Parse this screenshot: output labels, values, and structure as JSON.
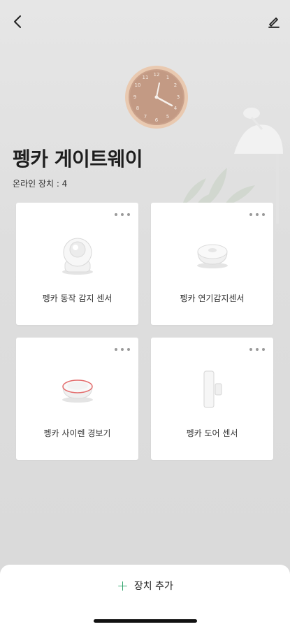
{
  "header": {
    "back_icon": "chevron-left-icon",
    "edit_icon": "pencil-icon"
  },
  "hub": {
    "title": "펭카 게이트웨이",
    "online_label": "온라인 장치 :  4"
  },
  "devices": [
    {
      "name": "펭카 동작 감지 센서",
      "icon": "motion-sensor-icon"
    },
    {
      "name": "펭카 연기감지센서",
      "icon": "smoke-detector-icon"
    },
    {
      "name": "펭카 사이렌 경보기",
      "icon": "siren-icon"
    },
    {
      "name": "펭카 도어 센서",
      "icon": "door-sensor-icon"
    }
  ],
  "footer": {
    "add_label": "장치 추가",
    "accent": "#2fa36b"
  }
}
